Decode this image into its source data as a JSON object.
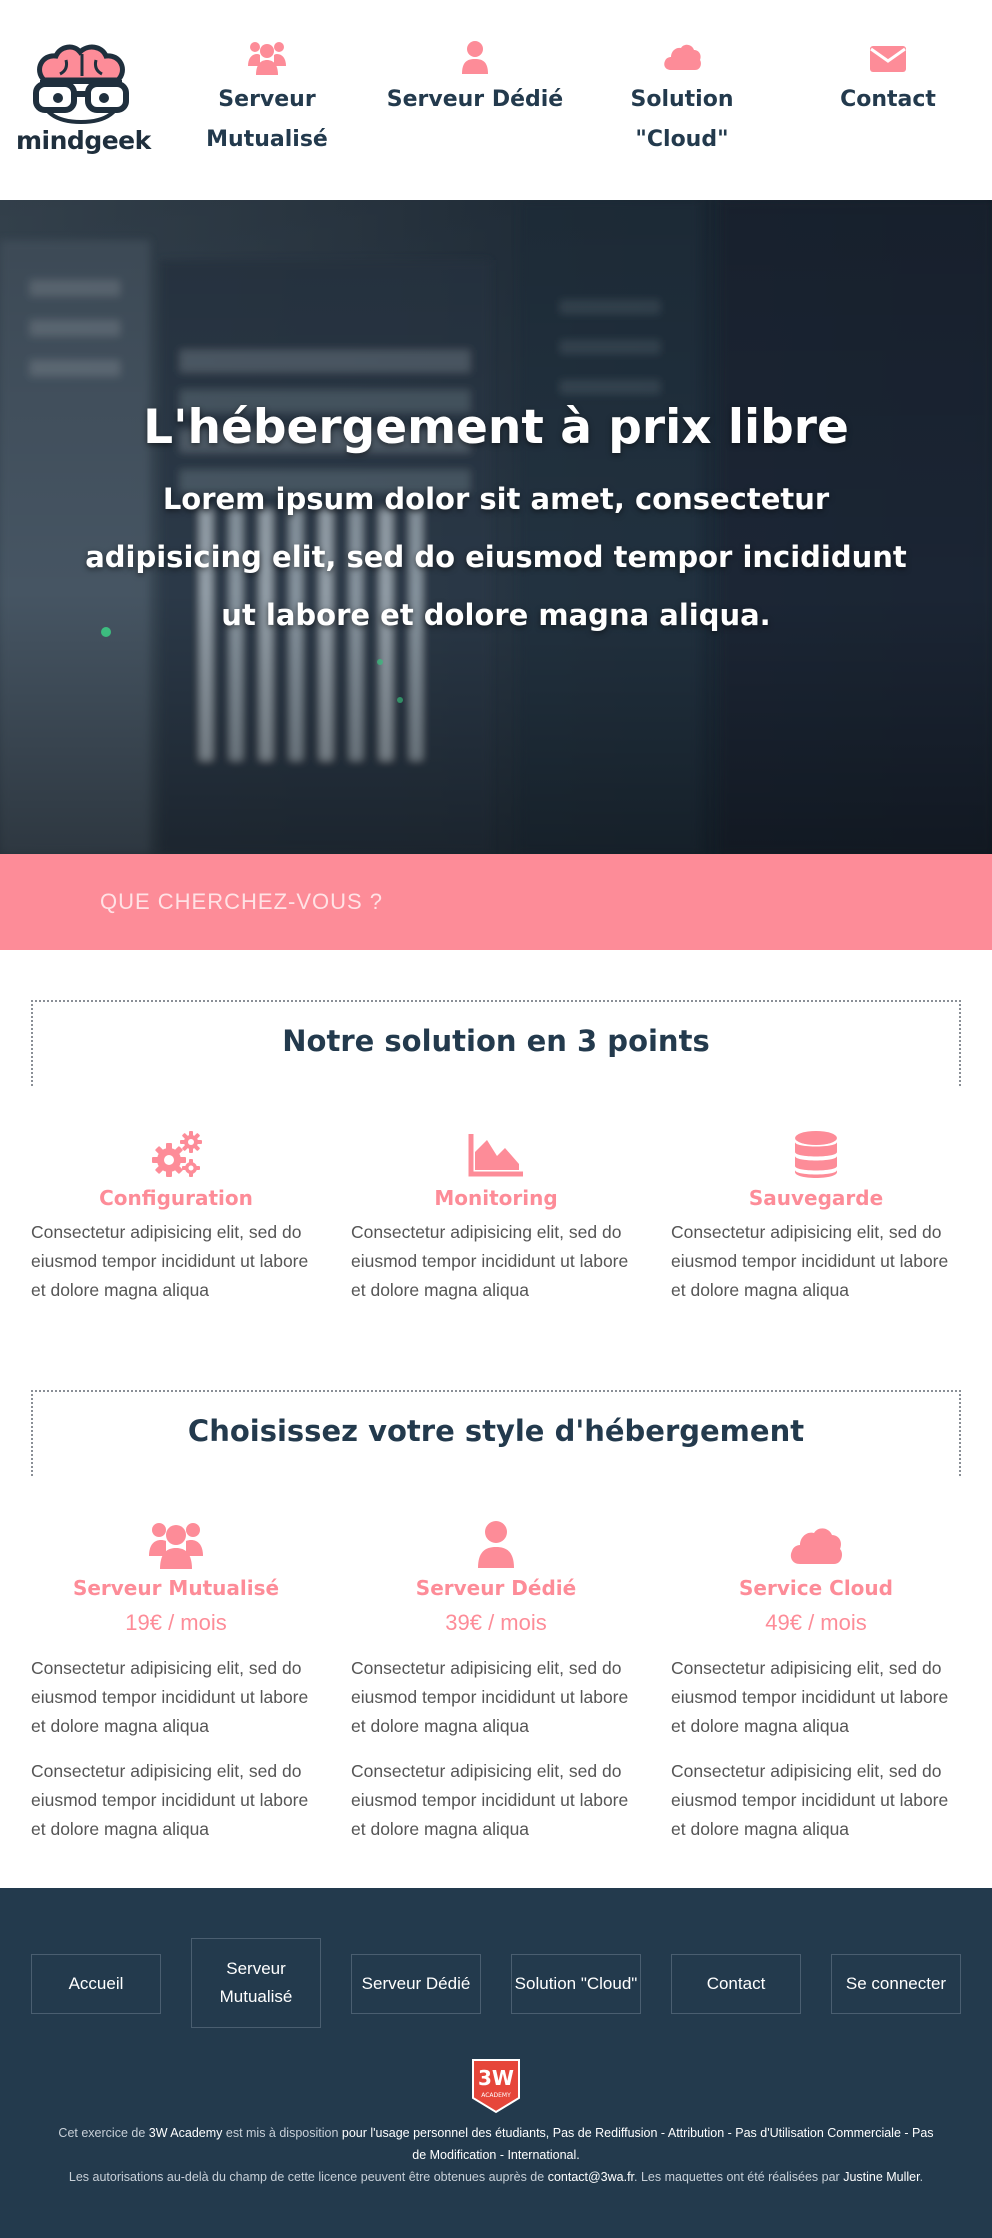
{
  "header": {
    "logo_text": "mindgeek",
    "nav": [
      {
        "icon": "users-icon",
        "label_line1": "Serveur",
        "label_line2": "Mutualisé"
      },
      {
        "icon": "user-icon",
        "label_line1": "Serveur Dédié",
        "label_line2": ""
      },
      {
        "icon": "cloud-icon",
        "label_line1": "Solution",
        "label_line2": "\"Cloud\""
      },
      {
        "icon": "envelope-icon",
        "label_line1": "Contact",
        "label_line2": ""
      }
    ]
  },
  "hero": {
    "title": "L'hébergement à prix libre",
    "subtitle": "Lorem ipsum dolor sit amet, consectetur adipisicing elit, sed do eiusmod tempor incididunt ut labore et dolore magna aliqua."
  },
  "search": {
    "placeholder": "QUE CHERCHEZ-VOUS ?"
  },
  "solution": {
    "title": "Notre solution en 3 points",
    "items": [
      {
        "icon": "gears-icon",
        "title": "Configuration",
        "text": "Consectetur adipisicing elit, sed do eiusmod tempor incididunt ut labore et dolore magna aliqua"
      },
      {
        "icon": "area-chart-icon",
        "title": "Monitoring",
        "text": "Consectetur adipisicing elit, sed do eiusmod tempor incididunt ut labore et dolore magna aliqua"
      },
      {
        "icon": "database-icon",
        "title": "Sauvegarde",
        "text": "Consectetur adipisicing elit, sed do eiusmod tempor incididunt ut labore et dolore magna aliqua"
      }
    ]
  },
  "hosting": {
    "title": "Choisissez votre style d'hébergement",
    "plans": [
      {
        "icon": "users-icon",
        "title": "Serveur Mutualisé",
        "price": "19€ / mois",
        "text1": "Consectetur adipisicing elit, sed do eiusmod tempor incididunt ut labore et dolore magna aliqua",
        "text2": "Consectetur adipisicing elit, sed do eiusmod tempor incididunt ut labore et dolore magna aliqua"
      },
      {
        "icon": "user-icon",
        "title": "Serveur Dédié",
        "price": "39€ / mois",
        "text1": "Consectetur adipisicing elit, sed do eiusmod tempor incididunt ut labore et dolore magna aliqua",
        "text2": "Consectetur adipisicing elit, sed do eiusmod tempor incididunt ut labore et dolore magna aliqua"
      },
      {
        "icon": "cloud-icon",
        "title": "Service Cloud",
        "price": "49€ / mois",
        "text1": "Consectetur adipisicing elit, sed do eiusmod tempor incididunt ut labore et dolore magna aliqua",
        "text2": "Consectetur adipisicing elit, sed do eiusmod tempor incididunt ut labore et dolore magna aliqua"
      }
    ]
  },
  "footer": {
    "buttons": [
      {
        "label": "Accueil"
      },
      {
        "label": "Serveur Mutualisé"
      },
      {
        "label": "Serveur Dédié"
      },
      {
        "label": "Solution \"Cloud\""
      },
      {
        "label": "Contact"
      },
      {
        "label": "Se connecter"
      }
    ],
    "badge_text": "3W",
    "badge_sub": "ACADEMY",
    "license": {
      "t1": "Cet exercice de ",
      "academy": "3W Academy",
      "t2": " est mis à disposition ",
      "usage": "pour l'usage personnel des étudiants, Pas de Rediffusion - Attribution - Pas d'Utilisation Commerciale - Pas de Modification - International.",
      "t3": "Les autorisations au-delà du champ de cette licence peuvent être obtenues auprès de ",
      "email": "contact@3wa.fr",
      "t4": ". Les maquettes ont été réalisées par ",
      "author": "Justine Muller",
      "t5": "."
    }
  },
  "colors": {
    "navy": "#233a4d",
    "pink": "#fd8c98",
    "white": "#ffffff"
  }
}
